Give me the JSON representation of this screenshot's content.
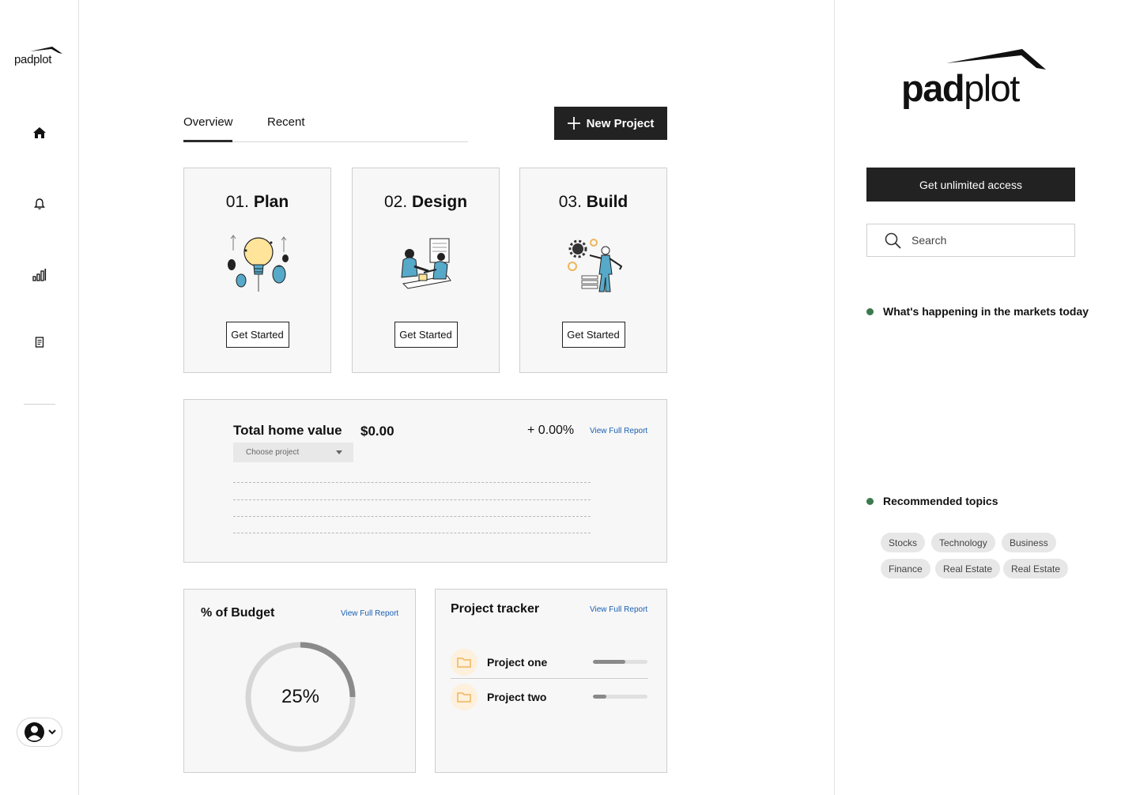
{
  "sidebar": {
    "logo": {
      "part1": "pad",
      "part2": "plot"
    },
    "nav": [
      {
        "icon": "home-icon"
      },
      {
        "icon": "bell-icon"
      },
      {
        "icon": "bar-chart-icon"
      },
      {
        "icon": "document-icon"
      }
    ],
    "user": {
      "icon": "user-avatar-icon"
    }
  },
  "main": {
    "tabs": [
      {
        "label": "Overview",
        "active": true
      },
      {
        "label": "Recent",
        "active": false
      }
    ],
    "new_project_label": "New Project",
    "steps": [
      {
        "num": "01.",
        "name": "Plan",
        "button": "Get Started",
        "illustration": "lightbulb-balloons-illustration"
      },
      {
        "num": "02.",
        "name": "Design",
        "button": "Get Started",
        "illustration": "designers-desk-illustration"
      },
      {
        "num": "03.",
        "name": "Build",
        "button": "Get Started",
        "illustration": "worker-gears-illustration"
      }
    ],
    "home_value": {
      "title": "Total home value",
      "value": "$0.00",
      "change": "+ 0.00%",
      "link": "View Full Report",
      "select_placeholder": "Choose project"
    },
    "budget": {
      "title": "% of Budget",
      "link": "View Full Report",
      "percent_label": "25%",
      "percent": 25
    },
    "tracker": {
      "title": "Project tracker",
      "link": "View Full Report",
      "projects": [
        {
          "name": "Project one",
          "progress": 0.6
        },
        {
          "name": "Project two",
          "progress": 0.25
        }
      ]
    }
  },
  "right": {
    "logo": {
      "part1": "pad",
      "part2": "plot"
    },
    "cta": "Get unlimited access",
    "search_placeholder": "Search",
    "markets_heading": "What's happening in the markets today",
    "topics_heading": "Recommended topics",
    "topics": [
      "Stocks",
      "Technology",
      "Business",
      "Finance",
      "Real Estate",
      "Real Estate"
    ],
    "accent_color": "#3c7a4f"
  }
}
